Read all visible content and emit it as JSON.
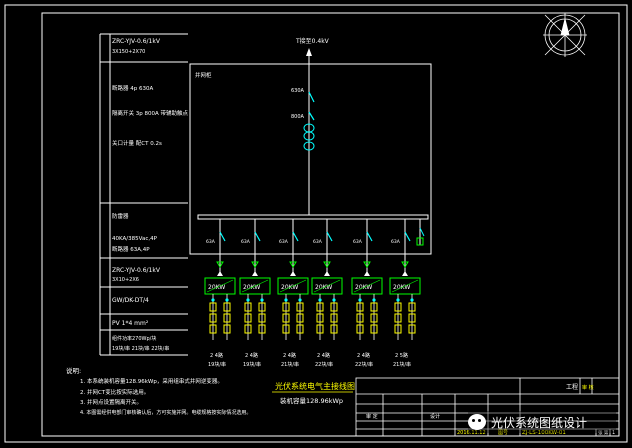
{
  "title_block": {
    "drawing_title": "光伏系统电气主接线图",
    "capacity": "装机容量128.96kWp",
    "project_label": "工程",
    "approve_label": "审 核",
    "check_label": "审 定",
    "design_label": "设计",
    "drawing_no_label": "图号",
    "date": "2016.11.12",
    "drawing_no": "ZJ-LS-100KW-01",
    "sheet_label": "张 第",
    "sheet": "1"
  },
  "top_feed": "T接至0.4kV",
  "left_labels": {
    "cable_top": "ZRC-YJV-0.6/1kV",
    "cable_top_spec": "3X150+2X70",
    "breaker": "断路器 4p 630A",
    "isolator": "隔离开关 3p 800A 带辅助触点",
    "meter": "关口计量 配CT 0.2s",
    "arrester_header": "防雷器",
    "arrester_a": "40KA/385Vac,4P",
    "arrester_b": "断路器 63A,4P",
    "cable_mid": "ZRC-YJV-0.6/1kV",
    "cable_mid_spec": "3X10+2X6",
    "cable_inv": "GW/DK-DT/4",
    "pv_cable": "PV 1*4 mm²",
    "module": "组件功率270Wp/块",
    "string_a": "19块/串 21块/串 22块/串"
  },
  "main_panel": {
    "label": "并网柜",
    "breaker_rating": "630A",
    "isolator_rating": "800A"
  },
  "feeders": [
    {
      "breaker": "63A",
      "inverter": "20KW",
      "strings": "2 4路",
      "modules": "19块/串"
    },
    {
      "breaker": "63A",
      "inverter": "20KW",
      "strings": "2 4路",
      "modules": "19块/串"
    },
    {
      "breaker": "63A",
      "inverter": "20KW",
      "strings": "2 4路",
      "modules": "21块/串"
    },
    {
      "breaker": "63A",
      "inverter": "20KW",
      "strings": "2 4路",
      "modules": "22块/串"
    },
    {
      "breaker": "63A",
      "inverter": "20KW",
      "strings": "2 4路",
      "modules": "22块/串"
    },
    {
      "breaker": "63A",
      "inverter": "20KW",
      "strings": "2 5路",
      "modules": "21块/串"
    }
  ],
  "notes": {
    "header": "说明:",
    "items": [
      "1. 本系统装机容量128.96kWp，采用组串式并网逆变器。",
      "2. 并网CT变比按实际选用。",
      "3. 并网点设置隔离开关。",
      "4. 本图需经供电部门审核确认后，方可实施并网。电缆规格按实际情况选用。"
    ]
  },
  "watermark": "光伏系统图纸设计",
  "colors": {
    "frame": "#ffffff",
    "bus": "#ffffff",
    "device": "#00ff00",
    "switch": "#00ffff",
    "string": "#ffff00",
    "label": "#ffffff",
    "title": "#ffff00",
    "accent": "#ff0000"
  }
}
